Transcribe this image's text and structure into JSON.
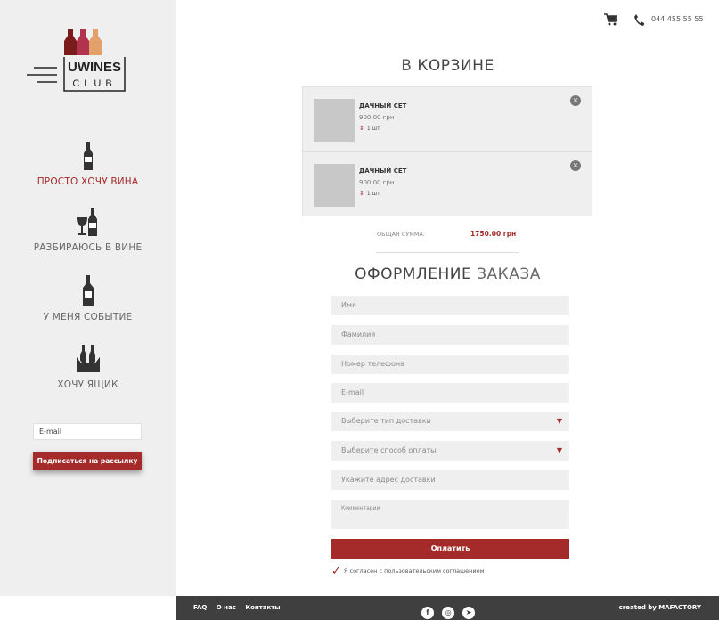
{
  "colors": {
    "accent": "#a52a2a",
    "sidebar": "#efefef",
    "footer": "#3f3f3f"
  },
  "logo": {
    "top_text": "UWINES",
    "bottom_text": "CLUB"
  },
  "sidebar": {
    "items": [
      {
        "label": "ПРОСТО ХОЧУ ВИНА",
        "icon": "wine-bottle-icon"
      },
      {
        "label": "РАЗБИРАЮСЬ В ВИНЕ",
        "icon": "glass-and-bottle-icon"
      },
      {
        "label": "У МЕНЯ СОБЫТИЕ",
        "icon": "champagne-icon"
      },
      {
        "label": "ХОЧУ ЯЩИК",
        "icon": "wine-box-icon"
      }
    ],
    "email_value": "E-mail",
    "subscribe_label": "Подписаться на рассылку"
  },
  "header": {
    "phone": "044 455 55 55"
  },
  "cart": {
    "title_light": "В",
    "title_bold": "КОРЗИНЕ",
    "items": [
      {
        "name": "ДАЧНЫЙ СЕТ",
        "price": "900.00 грн",
        "qty": "1 шт"
      },
      {
        "name": "ДАЧНЫЙ СЕТ",
        "price": "900.00 грн",
        "qty": "1 шт"
      }
    ],
    "total_label": "ОБЩАЯ СУММА:",
    "total_value": "1750.00 грн"
  },
  "order": {
    "title_bold": "ОФОРМЛЕНИЕ",
    "title_light": "ЗАКАЗА",
    "fields": {
      "name": "Имя",
      "surname": "Фамилия",
      "phone": "Номер телефона",
      "email": "E-mail",
      "delivery": "Выберите тип доставки",
      "payment": "Выберите способ оплаты",
      "address": "Укажите адрес доставки",
      "comment": "Комментарии"
    },
    "pay_label": "Оплатить",
    "agree_text": "Я согласен с пользовательским соглашением"
  },
  "footer": {
    "links": [
      "FAQ",
      "О нас",
      "Контакты"
    ],
    "social": [
      "f",
      "◎",
      "➤"
    ],
    "credit": "created by MAFACTORY"
  }
}
